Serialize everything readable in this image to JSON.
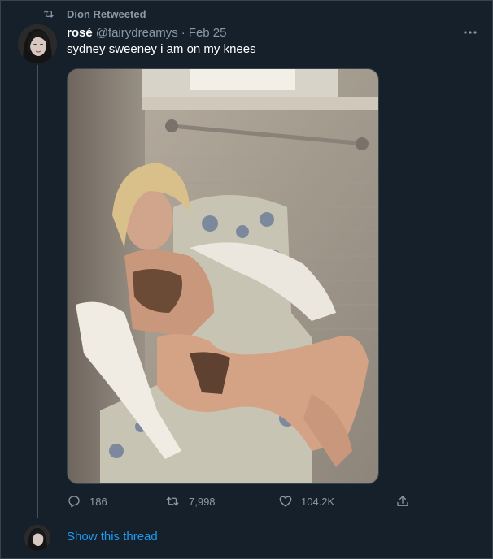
{
  "retweet": {
    "label": "Dion Retweeted"
  },
  "tweet": {
    "name": "rosé",
    "handle": "@fairydreamys",
    "separator": "·",
    "date": "Feb 25",
    "text": "sydney sweeney i am on my knees",
    "more_icon": "more-icon"
  },
  "actions": {
    "replies": "186",
    "retweets": "7,998",
    "likes": "104.2K"
  },
  "thread": {
    "show_label": "Show this thread"
  },
  "colors": {
    "background": "#15202b",
    "secondary_text": "#8b98a5",
    "link": "#1d9bf0"
  }
}
